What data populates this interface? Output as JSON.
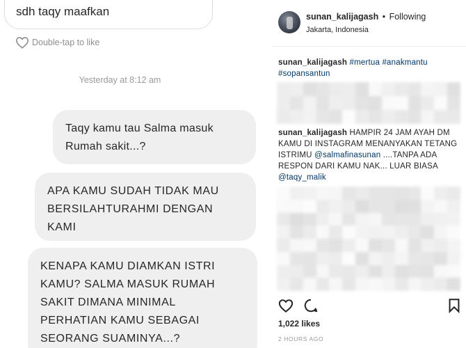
{
  "chat": {
    "top_message": "sdh taqy maafkan",
    "like_hint": "Double-tap to like",
    "timestamp": "Yesterday at 8:12 am",
    "messages": [
      "Taqy kamu tau Salma masuk Rumah sakit...?",
      "APA KAMU SUDAH TIDAK MAU BERSILAHTURAHMI DENGAN KAMI",
      "KENAPA KAMU DIAMKAN ISTRI KAMU? SALMA MASUK RUMAH SAKIT DIMANA MINIMAL PERHATIAN KAMU SEBAGAI SEORANG SUAMINYA...?"
    ]
  },
  "post": {
    "username": "sunan_kalijagash",
    "follow_separator": "•",
    "follow_status": "Following",
    "location": "Jakarta, Indonesia",
    "caption1": {
      "username": "sunan_kalijagash",
      "tags": "#mertua #anakmantu #sopansantun"
    },
    "caption2": {
      "username": "sunan_kalijagash",
      "text_a": "HAMPIR 24 JAM AYAH DM KAMU DI INSTAGRAM MENANYAKAN TETANG ISTRIMU",
      "mention_a": "@salmafinasunan",
      "text_b": "....TANPA ADA RESPON DARI KAMU NAK... LUAR BIASA",
      "mention_b": "@taqy_malik"
    },
    "likes": "1,022 likes",
    "time": "2 HOURS AGO",
    "icons": [
      "heart-icon",
      "comment-icon",
      "bookmark-icon"
    ],
    "colors": {
      "link": "#003569",
      "muted": "#999999",
      "bubble": "#efefef"
    }
  }
}
